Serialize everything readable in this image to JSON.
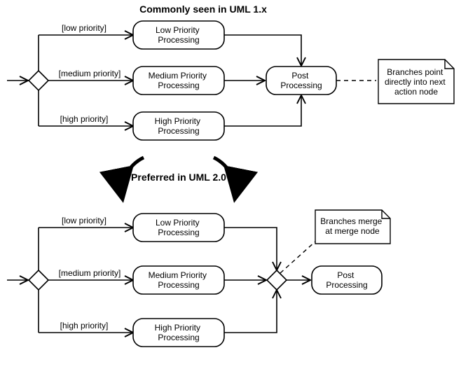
{
  "top": {
    "heading": "Commonly seen in UML 1.x",
    "guards": {
      "low": "[low priority]",
      "medium": "[medium priority]",
      "high": "[high priority]"
    },
    "actions": {
      "low": "Low Priority Processing",
      "medium": "Medium Priority Processing",
      "high": "High Priority Processing",
      "post": "Post Processing"
    },
    "note": "Branches point directly into next action node"
  },
  "transition": {
    "label": "Preferred in UML 2.0"
  },
  "bottom": {
    "guards": {
      "low": "[low priority]",
      "medium": "[medium priority]",
      "high": "[high priority]"
    },
    "actions": {
      "low": "Low Priority Processing",
      "medium": "Medium Priority Processing",
      "high": "High Priority Processing",
      "post": "Post Processing"
    },
    "note": "Branches merge at merge node"
  },
  "chart_data": {
    "type": "activity-diagram-comparison",
    "diagrams": [
      {
        "label": "Commonly seen in UML 1.x",
        "decision": "priority",
        "branches": [
          {
            "guard": "low priority",
            "action": "Low Priority Processing"
          },
          {
            "guard": "medium priority",
            "action": "Medium Priority Processing"
          },
          {
            "guard": "high priority",
            "action": "High Priority Processing"
          }
        ],
        "merge": {
          "kind": "direct-into-next-action",
          "target": "Post Processing"
        },
        "note": "Branches point directly into next action node"
      },
      {
        "label": "Preferred in UML 2.0",
        "decision": "priority",
        "branches": [
          {
            "guard": "low priority",
            "action": "Low Priority Processing"
          },
          {
            "guard": "medium priority",
            "action": "Medium Priority Processing"
          },
          {
            "guard": "high priority",
            "action": "High Priority Processing"
          }
        ],
        "merge": {
          "kind": "merge-node",
          "target": "Post Processing"
        },
        "note": "Branches merge at merge node"
      }
    ]
  }
}
